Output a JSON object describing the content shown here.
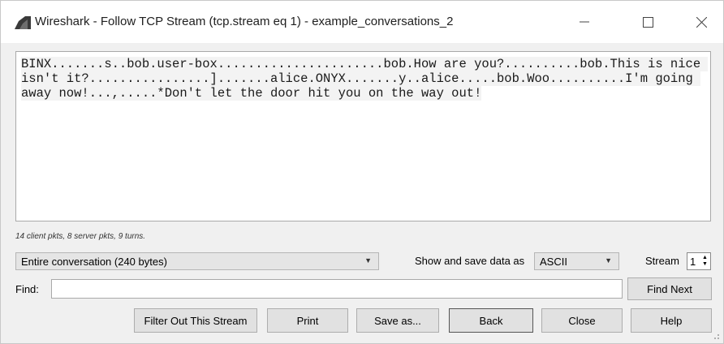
{
  "window": {
    "title": "Wireshark - Follow TCP Stream (tcp.stream eq 1) - example_conversations_2",
    "icon": "wireshark-fin-icon",
    "minimize_icon": "minimize-icon",
    "maximize_icon": "maximize-icon",
    "close_icon": "close-icon"
  },
  "stream": {
    "segments": [
      {
        "text": "BINX.......s..bob.user-box......................bob.How are you?..........bob.This is nice isn't it?................].......alice.ONYX.......y..alice.....bob.Woo..........I'm going away now!...,.....*Don't let the door hit you on the way out!"
      }
    ]
  },
  "summary": "14 client pkts, 8 server pkts, 9 turns.",
  "conversation_select": {
    "value": "Entire conversation (240 bytes)"
  },
  "show_save_label": "Show and save data as",
  "format_select": {
    "value": "ASCII"
  },
  "stream_label": "Stream",
  "stream_number": "1",
  "find": {
    "label": "Find:",
    "value": "",
    "placeholder": ""
  },
  "buttons": {
    "find_next": "Find Next",
    "filter_out": "Filter Out This Stream",
    "print": "Print",
    "save_as": "Save as...",
    "back": "Back",
    "close": "Close",
    "help": "Help"
  },
  "colors": {
    "window_bg": "#f0f0f0",
    "titlebar_bg": "#ffffff",
    "text_area_bg": "#ffffff",
    "segment_bg": "#f3f3f3"
  }
}
